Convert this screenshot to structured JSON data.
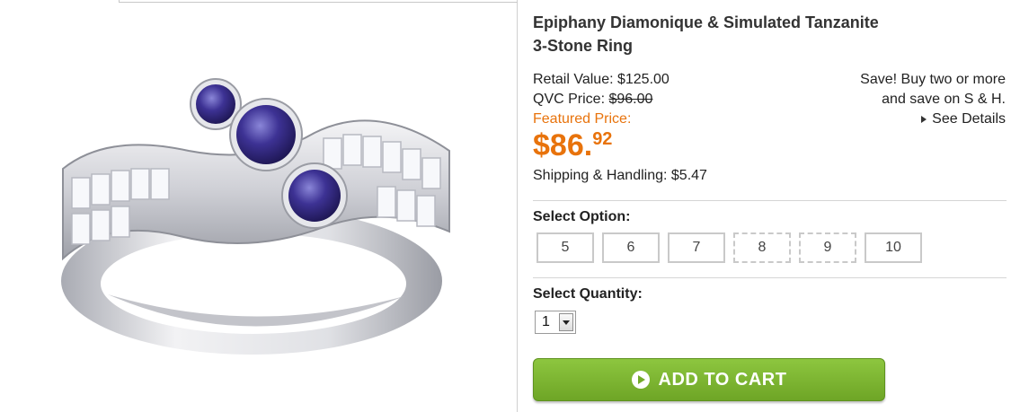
{
  "product": {
    "title_line1": "Epiphany Diamonique & Simulated Tanzanite",
    "title_line2": "3-Stone Ring",
    "image_alt": "3-stone ring image"
  },
  "pricing": {
    "retail_label": "Retail Value:",
    "retail_value": "$125.00",
    "qvc_label": "QVC Price:",
    "qvc_value": "$96.00",
    "featured_label": "Featured Price:",
    "featured_dollars": "$86.",
    "featured_cents": "92",
    "shipping_label": "Shipping & Handling:",
    "shipping_value": "$5.47"
  },
  "promo": {
    "line1": "Save! Buy two or more",
    "line2": "and save on S & H.",
    "see_details": "See Details"
  },
  "options": {
    "label": "Select Option:",
    "sizes": [
      "5",
      "6",
      "7",
      "8",
      "9",
      "10"
    ],
    "unavailable": [
      "8",
      "9"
    ]
  },
  "quantity": {
    "label": "Select Quantity:",
    "selected": "1"
  },
  "cart": {
    "button_label": "ADD TO CART"
  },
  "colors": {
    "accent_orange": "#e8730c",
    "cart_green": "#7bb52f",
    "stone_tanzanite": "#3b3090",
    "metal_silver": "#d9dadf"
  }
}
